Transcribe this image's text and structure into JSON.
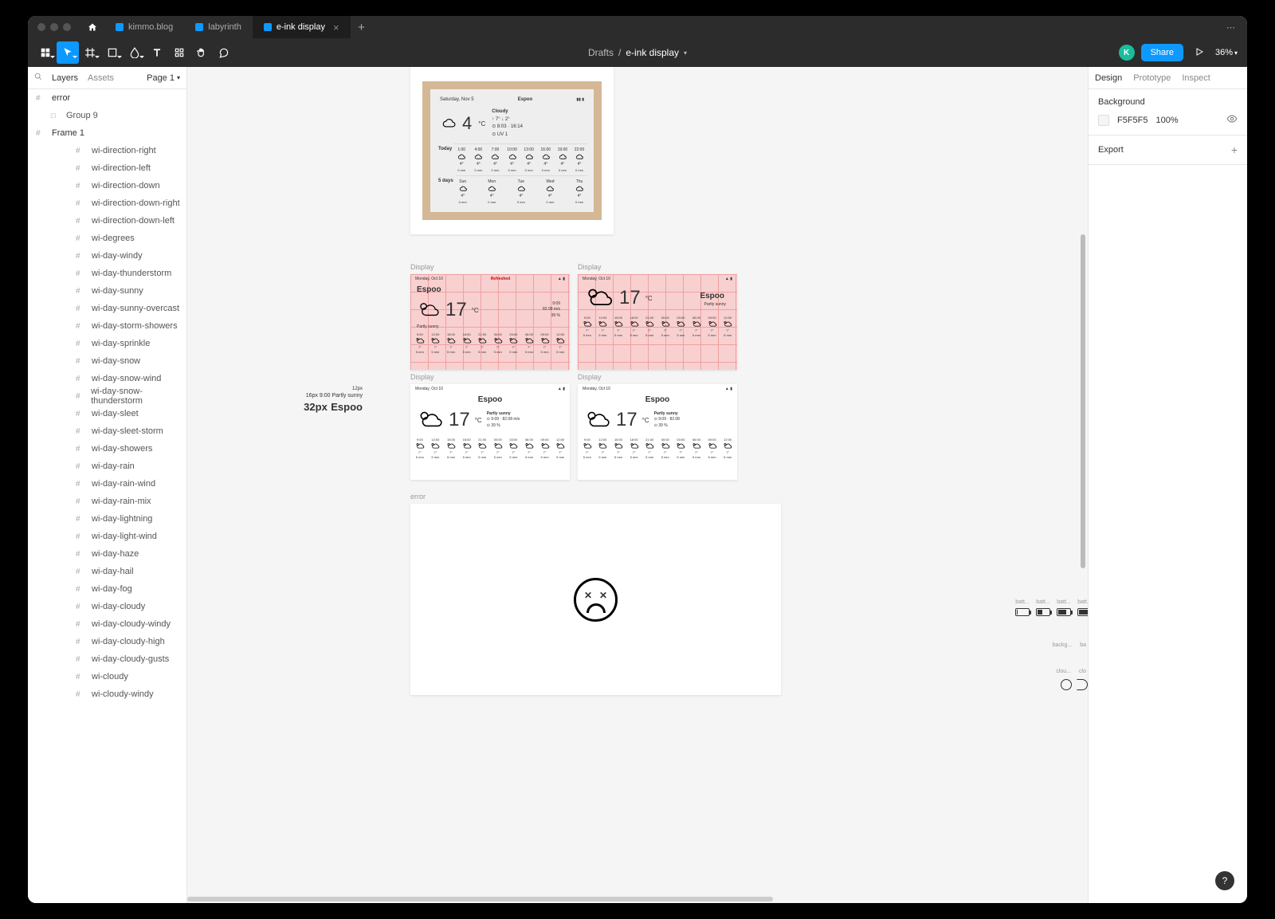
{
  "tabs": [
    {
      "label": "kimmo.blog",
      "active": false
    },
    {
      "label": "labyrinth",
      "active": false
    },
    {
      "label": "e-ink display",
      "active": true
    }
  ],
  "breadcrumb": {
    "parent": "Drafts",
    "current": "e-ink display"
  },
  "avatar_initial": "K",
  "share_label": "Share",
  "zoom_label": "36%",
  "left_panel": {
    "tabs": {
      "layers": "Layers",
      "assets": "Assets"
    },
    "page_label": "Page 1",
    "frames": [
      {
        "name": "error",
        "type": "frame",
        "children": [
          {
            "name": "Group 9",
            "type": "group"
          }
        ]
      },
      {
        "name": "Frame 1",
        "type": "frame",
        "children": [
          {
            "name": "wi-direction-right"
          },
          {
            "name": "wi-direction-left"
          },
          {
            "name": "wi-direction-down"
          },
          {
            "name": "wi-direction-down-right"
          },
          {
            "name": "wi-direction-down-left"
          },
          {
            "name": "wi-degrees"
          },
          {
            "name": "wi-day-windy"
          },
          {
            "name": "wi-day-thunderstorm"
          },
          {
            "name": "wi-day-sunny"
          },
          {
            "name": "wi-day-sunny-overcast"
          },
          {
            "name": "wi-day-storm-showers"
          },
          {
            "name": "wi-day-sprinkle"
          },
          {
            "name": "wi-day-snow"
          },
          {
            "name": "wi-day-snow-wind"
          },
          {
            "name": "wi-day-snow-thunderstorm"
          },
          {
            "name": "wi-day-sleet"
          },
          {
            "name": "wi-day-sleet-storm"
          },
          {
            "name": "wi-day-showers"
          },
          {
            "name": "wi-day-rain"
          },
          {
            "name": "wi-day-rain-wind"
          },
          {
            "name": "wi-day-rain-mix"
          },
          {
            "name": "wi-day-lightning"
          },
          {
            "name": "wi-day-light-wind"
          },
          {
            "name": "wi-day-haze"
          },
          {
            "name": "wi-day-hail"
          },
          {
            "name": "wi-day-fog"
          },
          {
            "name": "wi-day-cloudy"
          },
          {
            "name": "wi-day-cloudy-windy"
          },
          {
            "name": "wi-day-cloudy-high"
          },
          {
            "name": "wi-day-cloudy-gusts"
          },
          {
            "name": "wi-cloudy"
          },
          {
            "name": "wi-cloudy-windy"
          }
        ]
      }
    ]
  },
  "right_panel": {
    "tabs": {
      "design": "Design",
      "prototype": "Prototype",
      "inspect": "Inspect"
    },
    "background": {
      "label": "Background",
      "hex": "F5F5F5",
      "opacity": "100%"
    },
    "export_label": "Export"
  },
  "canvas": {
    "displays": [
      {
        "label": "Display",
        "city": "Espoo",
        "date": "Monday, Oct 10",
        "temp": "17",
        "unit": "°C",
        "cond": "Partly sunny",
        "extra1": "9:09",
        "extra2": "82.08 m/s",
        "extra3": "39 %",
        "hours": [
          "9:00",
          "12:00",
          "15:00",
          "18:00",
          "21:00",
          "00:00",
          "03:00",
          "06:00",
          "09:00",
          "12:00"
        ],
        "highlight": "Refreshed"
      },
      {
        "label": "Display",
        "city": "Espoo",
        "date": "Monday, Oct 10",
        "temp": "17",
        "unit": "°C",
        "cond": "Partly sunny",
        "hours": [
          "9:00",
          "12:00",
          "15:00",
          "18:00",
          "21:00",
          "00:00",
          "03:00",
          "06:00",
          "09:00",
          "12:00"
        ]
      },
      {
        "label": "Display",
        "city": "Espoo",
        "date": "Monday, Oct 10",
        "temp": "17",
        "unit": "°C",
        "cond": "Partly sunny",
        "extra1": "9:09",
        "extra2": "82.08 m/s",
        "extra3": "39 %",
        "hours": [
          "9:00",
          "12:00",
          "15:00",
          "18:00",
          "21:00",
          "00:00",
          "03:00",
          "06:00",
          "09:00",
          "12:00"
        ]
      },
      {
        "label": "Display",
        "city": "Espoo",
        "date": "Monday, Oct 10",
        "temp": "17",
        "unit": "°C",
        "cond": "Partly sunny",
        "hours": [
          "9:00",
          "12:00",
          "15:00",
          "18:00",
          "21:00",
          "00:00",
          "03:00",
          "06:00",
          "09:00",
          "12:00"
        ]
      }
    ],
    "hourly_temp": "7°",
    "hourly_sub": "5 mm",
    "mockup": {
      "date": "Saturday, Nov 5",
      "city": "Espoo",
      "temp": "4",
      "unit": "°C",
      "condition": "Cloudy",
      "rows": [
        {
          "label": "Today",
          "times": [
            "1:00",
            "4:00",
            "7:00",
            "10:00",
            "13:00",
            "16:00",
            "19:00",
            "22:00"
          ]
        },
        {
          "label": "5 days",
          "times": [
            "Sun",
            "Mon",
            "Tue",
            "Wed",
            "Thu"
          ]
        }
      ]
    },
    "typo": {
      "l1": "12px",
      "l2": "16px  9:00  Partly sunny",
      "l3_a": "32px",
      "l3_b": "Espoo"
    },
    "error_label": "error",
    "battery_labels": [
      "batt...",
      "batt...",
      "batt...",
      "batt..."
    ],
    "battery_levels": [
      10,
      40,
      70,
      95
    ],
    "bg_labels": [
      "backg...",
      "ba"
    ],
    "cloud_labels": [
      "clou...",
      "clo"
    ]
  }
}
